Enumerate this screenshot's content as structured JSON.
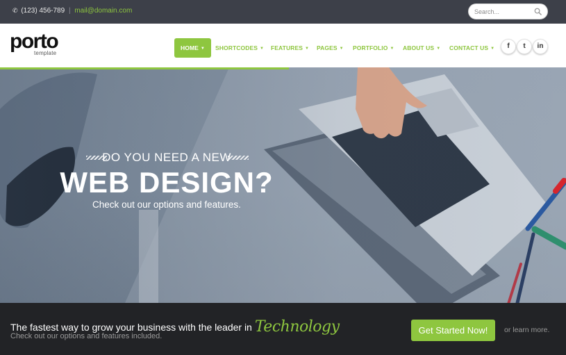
{
  "topbar": {
    "phone": "(123) 456-789",
    "separator": "|",
    "email": "mail@domain.com",
    "search_placeholder": "Search..."
  },
  "logo": {
    "word": "porto",
    "sub": "template"
  },
  "nav": {
    "items": [
      {
        "label": "HOME",
        "active": true
      },
      {
        "label": "SHORTCODES",
        "active": false
      },
      {
        "label": "FEATURES",
        "active": false
      },
      {
        "label": "PAGES",
        "active": false
      },
      {
        "label": "PORTFOLIO",
        "active": false
      },
      {
        "label": "ABOUT US",
        "active": false
      },
      {
        "label": "CONTACT US",
        "active": false
      }
    ],
    "caret": "▼"
  },
  "social": [
    {
      "icon": "facebook-icon",
      "glyph": "f"
    },
    {
      "icon": "twitter-icon",
      "glyph": "t"
    },
    {
      "icon": "linkedin-icon",
      "glyph": "in"
    }
  ],
  "hero": {
    "slider_progress_percent": 51,
    "kicker": "DO YOU NEED A NEW",
    "headline": "WEB DESIGN?",
    "subline": "Check out our options and features."
  },
  "cta": {
    "lead": "The fastest way to grow your business with the leader in",
    "accent": "Technology",
    "sub": "Check out our options and features included.",
    "button": "Get Started Now!",
    "learn_more": "or learn more."
  },
  "colors": {
    "accent": "#8ec63f",
    "topbar": "#3d4049",
    "cta_bg": "#222326"
  }
}
